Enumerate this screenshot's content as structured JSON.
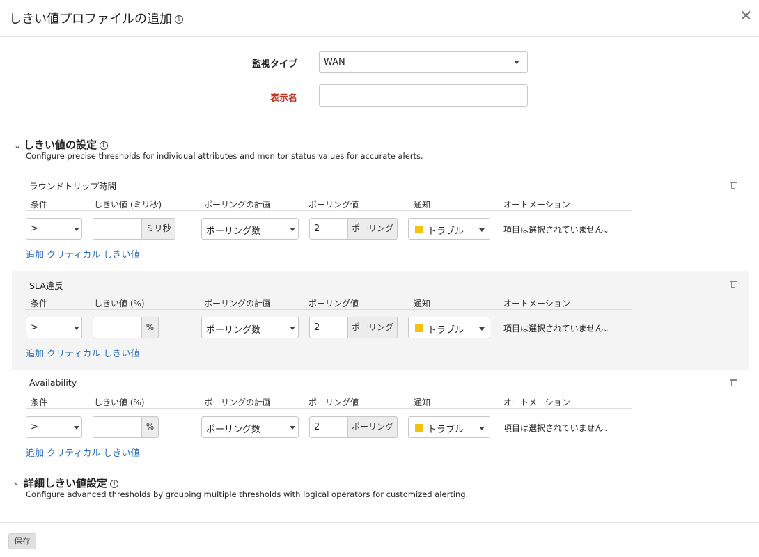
{
  "dialog": {
    "title": "しきい値プロファイルの追加",
    "info_glyph": "i",
    "close_glyph": "✕"
  },
  "form": {
    "monitor_type_label": "監視タイプ",
    "monitor_type_value": "WAN",
    "display_name_label": "表示名",
    "display_name_value": "",
    "required_color": "#c0392b"
  },
  "threshold_section": {
    "title": "しきい値の設定",
    "description": "Configure precise thresholds for individual attributes and monitor status values for accurate alerts.",
    "chevron": "⌄"
  },
  "columns": {
    "condition": "条件",
    "polling_plan": "ポーリングの計画",
    "polling_value": "ポーリング値",
    "notify": "通知",
    "automation": "オートメーション"
  },
  "blocks": [
    {
      "title": "ラウンドトリップ時間",
      "threshold_header": "しきい値 (ミリ秒)",
      "condition": ">",
      "threshold_value": "",
      "unit": "ミリ秒",
      "polling_plan": "ポーリング数",
      "polling_value": "2",
      "polling_unit": "ポーリング",
      "notify": "トラブル",
      "automation": "項目は選択されていません",
      "add_link": "追加 クリティカル しきい値"
    },
    {
      "title": "SLA違反",
      "threshold_header": "しきい値 (%)",
      "condition": ">",
      "threshold_value": "",
      "unit": "%",
      "polling_plan": "ポーリング数",
      "polling_value": "2",
      "polling_unit": "ポーリング",
      "notify": "トラブル",
      "automation": "項目は選択されていません",
      "add_link": "追加 クリティカル しきい値"
    },
    {
      "title": "Availability",
      "threshold_header": "しきい値 (%)",
      "condition": ">",
      "threshold_value": "",
      "unit": "%",
      "polling_plan": "ポーリング数",
      "polling_value": "2",
      "polling_unit": "ポーリング",
      "notify": "トラブル",
      "automation": "項目は選択されていません",
      "add_link": "追加 クリティカル しきい値"
    }
  ],
  "advanced_section": {
    "title": "詳細しきい値設定",
    "description": "Configure advanced thresholds by grouping multiple thresholds with logical operators for customized alerting.",
    "chevron": "›"
  },
  "footer": {
    "save_label": "保存"
  },
  "colors": {
    "link": "#2a6fbd",
    "notify_swatch": "#f4c20d",
    "shaded_block": "#f4f4f4"
  }
}
